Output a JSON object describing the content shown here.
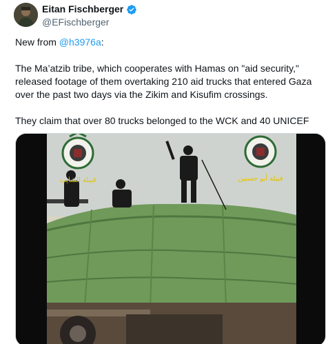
{
  "author": {
    "display_name": "Eitan Fischberger",
    "handle": "@EFischberger",
    "verified": true
  },
  "tweet": {
    "line1_prefix": "New from ",
    "mention": "@h3976a",
    "line1_suffix": ":",
    "paragraph2": "The Ma’atzib tribe, which cooperates with Hamas on \"aid security,\" released footage of them overtaking 210 aid trucks that entered Gaza over the past two days via the Zikim and Kisufim crossings.",
    "paragraph3": "They claim that over 80 trucks belonged to the WCK and 40 UNICEF"
  },
  "media": {
    "type": "video-frame",
    "left_logo_caption": "قبيلة الشايب",
    "right_logo_caption": "قبيلة أبو حسنين"
  },
  "colors": {
    "link": "#1d9bf0",
    "verified": "#1d9bf0",
    "handle": "#536471",
    "tarp": "#6f9a5a"
  },
  "icons": {
    "verified": "verified-badge-icon"
  }
}
